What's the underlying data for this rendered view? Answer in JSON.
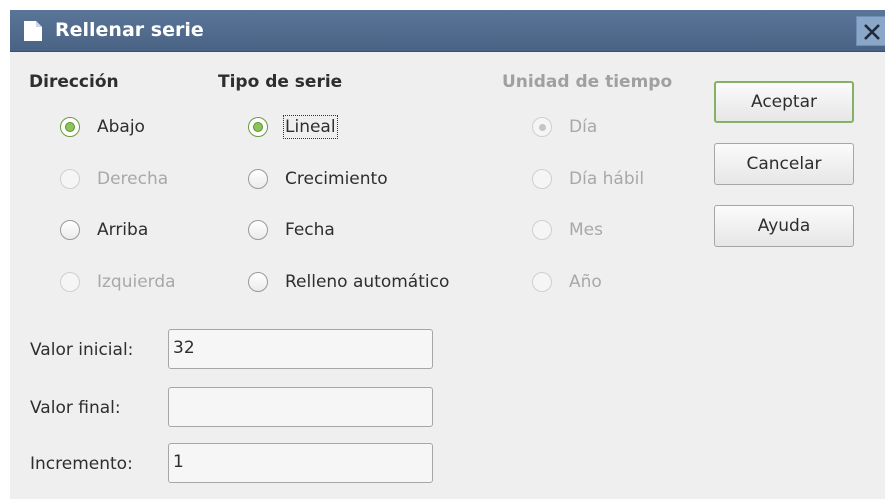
{
  "window": {
    "title": "Rellenar serie"
  },
  "direction": {
    "heading": "Dirección",
    "options": [
      {
        "label": "Abajo",
        "checked": true,
        "enabled": true
      },
      {
        "label": "Derecha",
        "checked": false,
        "enabled": false
      },
      {
        "label": "Arriba",
        "checked": false,
        "enabled": true
      },
      {
        "label": "Izquierda",
        "checked": false,
        "enabled": false
      }
    ]
  },
  "series_type": {
    "heading": "Tipo de serie",
    "options": [
      {
        "label": "Lineal",
        "checked": true,
        "enabled": true
      },
      {
        "label": "Crecimiento",
        "checked": false,
        "enabled": true
      },
      {
        "label": "Fecha",
        "checked": false,
        "enabled": true
      },
      {
        "label": "Relleno automático",
        "checked": false,
        "enabled": true
      }
    ]
  },
  "time_unit": {
    "heading": "Unidad de tiempo",
    "options": [
      {
        "label": "Día",
        "checked": true,
        "enabled": false
      },
      {
        "label": "Día hábil",
        "checked": false,
        "enabled": false
      },
      {
        "label": "Mes",
        "checked": false,
        "enabled": false
      },
      {
        "label": "Año",
        "checked": false,
        "enabled": false
      }
    ]
  },
  "buttons": {
    "ok": "Aceptar",
    "cancel": "Cancelar",
    "help": "Ayuda"
  },
  "fields": {
    "start": {
      "label": "Valor inicial:",
      "value": "32"
    },
    "end": {
      "label": "Valor final:",
      "value": ""
    },
    "increment": {
      "label": "Incremento:",
      "value": "1"
    }
  },
  "colors": {
    "titlebar": "#4f6a8f",
    "accent": "#8ac557",
    "dialog_bg": "#efefef"
  }
}
